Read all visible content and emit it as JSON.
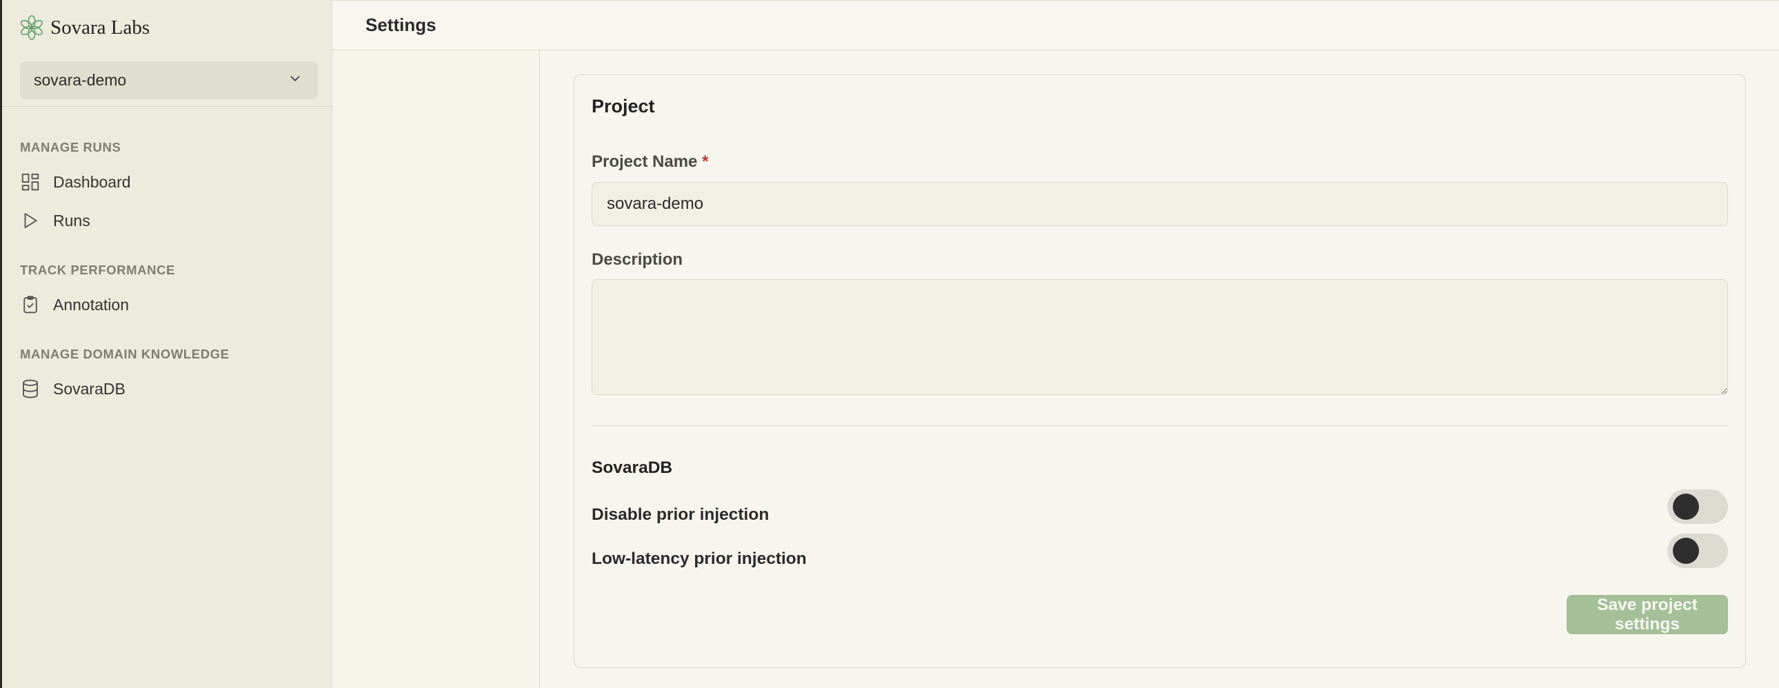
{
  "brand": {
    "name": "Sovara Labs",
    "icon": "flower-logo-icon"
  },
  "project_selector": {
    "value": "sovara-demo",
    "icon": "chevron-down-icon"
  },
  "sidebar": {
    "sections": [
      {
        "label": "MANAGE RUNS",
        "items": [
          {
            "label": "Dashboard",
            "icon": "dashboard-grid-icon"
          },
          {
            "label": "Runs",
            "icon": "play-icon"
          }
        ]
      },
      {
        "label": "TRACK PERFORMANCE",
        "items": [
          {
            "label": "Annotation",
            "icon": "clipboard-check-icon"
          }
        ]
      },
      {
        "label": "MANAGE DOMAIN KNOWLEDGE",
        "items": [
          {
            "label": "SovaraDB",
            "icon": "database-icon"
          }
        ]
      }
    ]
  },
  "header": {
    "title": "Settings"
  },
  "project_card": {
    "title": "Project",
    "name_label": "Project Name",
    "required_mark": "*",
    "name_value": "sovara-demo",
    "description_label": "Description",
    "description_value": "",
    "sovaradb": {
      "title": "SovaraDB",
      "toggles": [
        {
          "label": "Disable prior injection",
          "on": false
        },
        {
          "label": "Low-latency prior injection",
          "on": false
        }
      ]
    },
    "save_label": "Save project settings"
  },
  "colors": {
    "accent_button": "#a5bf98",
    "brand_logo": "#5f9a6b",
    "required": "#b83a3a",
    "sidebar_bg": "#ecebdc"
  }
}
